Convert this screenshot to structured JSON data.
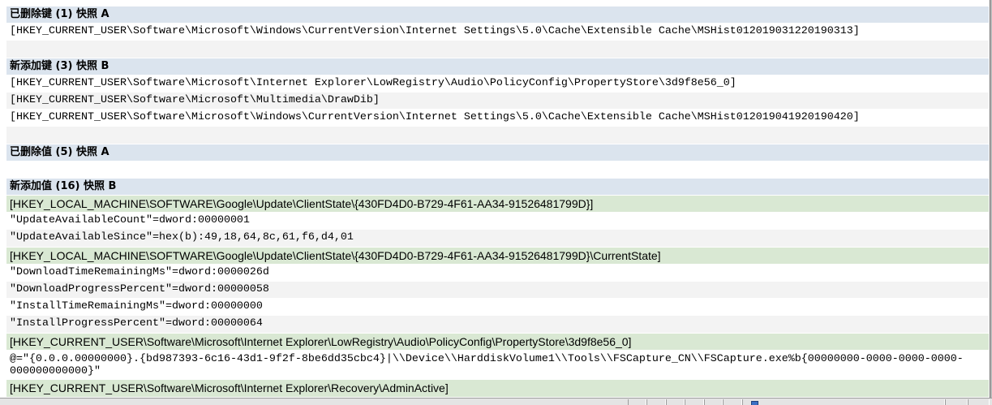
{
  "report": {
    "deleted_keys": {
      "title": "已删除键 (1) 快照 A",
      "items": [
        "[HKEY_CURRENT_USER\\Software\\Microsoft\\Windows\\CurrentVersion\\Internet Settings\\5.0\\Cache\\Extensible Cache\\MSHist012019031220190313]"
      ]
    },
    "added_keys": {
      "title": "新添加键 (3) 快照 B",
      "items": [
        "[HKEY_CURRENT_USER\\Software\\Microsoft\\Internet Explorer\\LowRegistry\\Audio\\PolicyConfig\\PropertyStore\\3d9f8e56_0]",
        "[HKEY_CURRENT_USER\\Software\\Microsoft\\Multimedia\\DrawDib]",
        "[HKEY_CURRENT_USER\\Software\\Microsoft\\Windows\\CurrentVersion\\Internet Settings\\5.0\\Cache\\Extensible Cache\\MSHist012019041920190420]"
      ]
    },
    "deleted_values": {
      "title": "已删除值 (5) 快照 A"
    },
    "added_values": {
      "title": "新添加值 (16) 快照 B",
      "groups": [
        {
          "key": "[HKEY_LOCAL_MACHINE\\SOFTWARE\\Google\\Update\\ClientState\\{430FD4D0-B729-4F61-AA34-91526481799D}]",
          "values": [
            "\"UpdateAvailableCount\"=dword:00000001",
            "\"UpdateAvailableSince\"=hex(b):49,18,64,8c,61,f6,d4,01"
          ]
        },
        {
          "key": "[HKEY_LOCAL_MACHINE\\SOFTWARE\\Google\\Update\\ClientState\\{430FD4D0-B729-4F61-AA34-91526481799D}\\CurrentState]",
          "values": [
            "\"DownloadTimeRemainingMs\"=dword:0000026d",
            "\"DownloadProgressPercent\"=dword:00000058",
            "\"InstallTimeRemainingMs\"=dword:00000000",
            "\"InstallProgressPercent\"=dword:00000064"
          ]
        },
        {
          "key": "[HKEY_CURRENT_USER\\Software\\Microsoft\\Internet Explorer\\LowRegistry\\Audio\\PolicyConfig\\PropertyStore\\3d9f8e56_0]",
          "values": [
            "@=\"{0.0.0.00000000}.{bd987393-6c16-43d1-9f2f-8be6dd35cbc4}|\\\\Device\\\\HarddiskVolume1\\\\Tools\\\\FSCapture_CN\\\\FSCapture.exe%b{00000000-0000-0000-0000-000000000000}\""
          ]
        },
        {
          "key": "[HKEY_CURRENT_USER\\Software\\Microsoft\\Internet Explorer\\Recovery\\AdminActive]",
          "values": []
        }
      ]
    }
  },
  "colors": {
    "section_header_bg": "#dbe4ee",
    "key_path_bg": "#d9e8d3",
    "alt_row_bg": "#f3f3f3",
    "row_bg": "#ffffff",
    "text": "#000000"
  },
  "status_bar": {
    "zone_icon": "internet-zone-icon"
  }
}
